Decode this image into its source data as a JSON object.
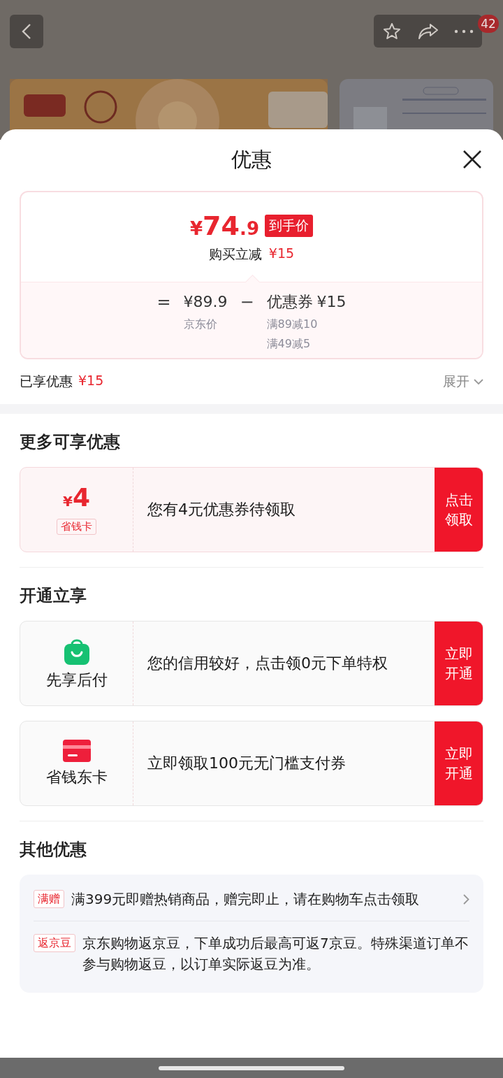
{
  "top_bar": {
    "badge": "42"
  },
  "sheet": {
    "title": "优惠"
  },
  "price_card": {
    "currency": "¥",
    "amount": "74",
    "fraction": ".9",
    "price_tag": "到手价",
    "discount_label": "购买立减",
    "discount_value": "¥15",
    "equals": "=",
    "base_price": "¥89.9",
    "base_label": "京东价",
    "minus": "−",
    "coupon_label": "优惠券",
    "coupon_value": "¥15",
    "coupon_rules": [
      "满89减10",
      "满49减5"
    ]
  },
  "enjoyed": {
    "label": "已享优惠",
    "value": "¥15",
    "expand_label": "展开",
    "expanded": false
  },
  "more_offers": {
    "heading": "更多可享优惠",
    "coupon": {
      "currency": "¥",
      "amount": "4",
      "tag": "省钱卡",
      "text": "您有4元优惠券待领取",
      "button": "点击领取"
    }
  },
  "activate": {
    "heading": "开通立享",
    "items": [
      {
        "kind": "bag",
        "label": "先享后付",
        "text": "您的信用较好，点击领0元下单特权",
        "button": "立即开通"
      },
      {
        "kind": "card",
        "label": "省钱东卡",
        "text": "立即领取100元无门槛支付券",
        "button": "立即开通"
      }
    ]
  },
  "other_offers": {
    "heading": "其他优惠",
    "items": [
      {
        "tag": "满赠",
        "text": "满399元即赠热销商品，赠完即止，请在购物车点击领取",
        "arrow": true
      },
      {
        "tag": "返京豆",
        "text": "京东购物返京豆，下单成功后最高可返7京豆。特殊渠道订单不参与购物返豆，以订单实际返豆为准。",
        "arrow": false
      }
    ]
  }
}
